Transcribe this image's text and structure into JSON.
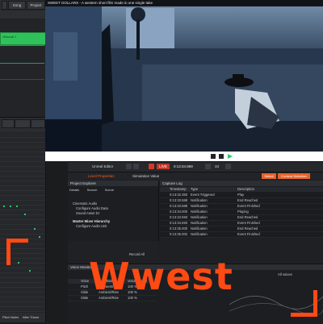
{
  "daw": {
    "menu": [
      "Song",
      "Project"
    ],
    "track_clip_label": "Gekordi 1",
    "bottom_buttons": [
      "Pitch Notes",
      "Alter Trksm"
    ]
  },
  "video": {
    "title": "SWEET DOLLARS - A western short film made in one single take"
  },
  "engine": {
    "toolbar": {
      "main_label": "Unreal Editor",
      "live_label": "LIVE",
      "time": "0:13:34.869",
      "frame": "33",
      "mode_label": "Simulation Value",
      "right_label_1": "Select",
      "right_label_2": "Content Selection"
    },
    "left_panel": {
      "header": "Level Properties",
      "tabs": [
        "Details",
        "Search",
        "Scene"
      ],
      "sub_header": "Project Explorer",
      "items": [
        "Cinematic Audio",
        "Configure Audio Data",
        "Sound Asset Dr",
        "Master Mixer Hierarchy",
        "Configure Audio Unit"
      ]
    },
    "event_log": {
      "header": "Capture Log",
      "columns": [
        "Timestamp",
        "Type",
        "Description"
      ],
      "rows": [
        {
          "ts": "0:13:32.393",
          "type": "Event Triggered",
          "desc": "Play"
        },
        {
          "ts": "0:13:33.588",
          "type": "Notification",
          "desc": "End Reached"
        },
        {
          "ts": "0:13:33.588",
          "type": "Notification",
          "desc": "Event Finished"
        },
        {
          "ts": "0:13:34.000",
          "type": "Notification",
          "desc": "Playing"
        },
        {
          "ts": "0:13:34.593",
          "type": "Notification",
          "desc": "End Reached"
        },
        {
          "ts": "0:13:34.593",
          "type": "Notification",
          "desc": "Event Finished"
        },
        {
          "ts": "0:13:35.000",
          "type": "Notification",
          "desc": "End Reached"
        },
        {
          "ts": "0:13:35.002",
          "type": "Notification",
          "desc": "Event Finished"
        }
      ]
    },
    "voice_monitor": {
      "header": "Voice Monitor",
      "columns": [
        "Voice",
        "Gain/Bus",
        "Voice Details"
      ],
      "rows": [
        {
          "voice": "Pitch",
          "bus": "Transient/Rise",
          "details": "100 %"
        },
        {
          "voice": "Slide",
          "bus": "Ambient/Rise",
          "details": "100 %"
        },
        {
          "voice": "Slide",
          "bus": "Ambient/Rise",
          "details": "100 %"
        }
      ],
      "filter_label": "All voices"
    },
    "misc_label": "Record All"
  },
  "overlay": {
    "brand_text": "Wwest",
    "brand_color": "#ff4a14"
  }
}
